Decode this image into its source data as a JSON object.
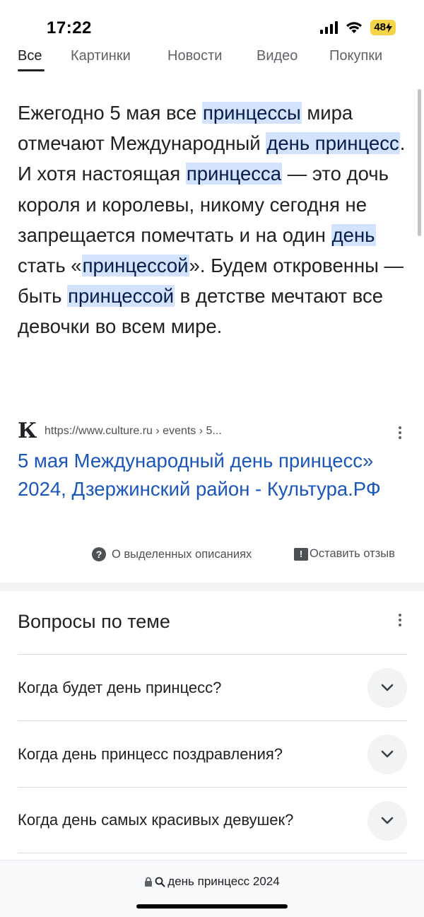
{
  "status": {
    "time": "17:22",
    "battery": "48"
  },
  "tabs": [
    {
      "label": "Все"
    },
    {
      "label": "Картинки"
    },
    {
      "label": "Новости"
    },
    {
      "label": "Видео"
    },
    {
      "label": "Покупки"
    }
  ],
  "snippet": {
    "p01": "Ежегодно 5 мая все ",
    "h01": "принцессы",
    "p02": " мира отмечают Международный ",
    "h02": "день принцесс",
    "p03": ". И хотя настоящая ",
    "h03": "принцесса",
    "p04": " — это дочь короля и королевы, никому сегодня не запрещается помечтать и на один ",
    "h04": "день",
    "p05": " стать «",
    "h05": "принцессой",
    "p06": "». Будем откровенны — быть ",
    "h06": "принцессой",
    "p07": " в детстве мечтают все девочки во всем мире."
  },
  "source": {
    "logo": "К",
    "url": "https://www.culture.ru › events › 5...",
    "title": "5 мая Международный день принцесс» 2024, Дзержинский район - Культура.РФ"
  },
  "featured_footer": {
    "about_label": "О выделенных описаниях",
    "feedback_label": "Оставить отзыв"
  },
  "paa": {
    "title": "Вопросы по теме",
    "questions": [
      "Когда будет день принцесс?",
      "Когда день принцесс поздравления?",
      "Когда день самых красивых девушек?"
    ]
  },
  "bottom": {
    "query": "день принцесс 2024"
  },
  "colors": {
    "highlight_bg": "#d3e3fd",
    "link": "#1a57b8",
    "battery": "#f5d547"
  }
}
